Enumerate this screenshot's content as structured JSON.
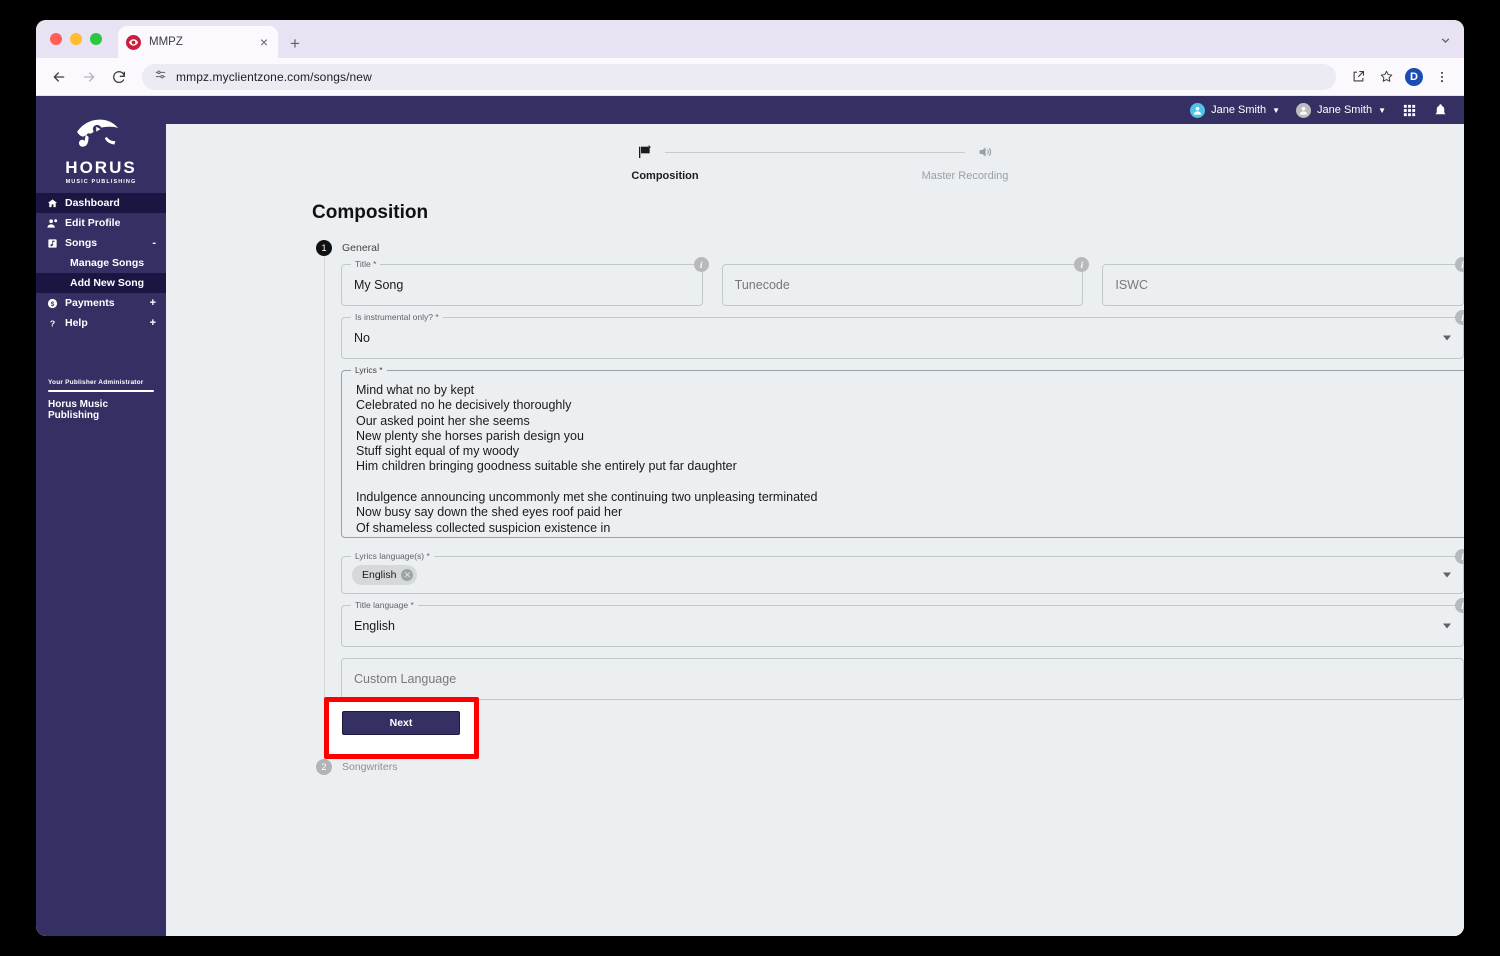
{
  "browser": {
    "tab": {
      "title": "MMPZ",
      "favicon": "horus-eye-favicon",
      "close": "×"
    },
    "new_tab": "+",
    "address": "mmpz.myclientzone.com/songs/new",
    "profile_initial": "D",
    "icons": [
      "back-arrow",
      "forward-arrow",
      "reload",
      "site-settings",
      "share",
      "bookmark-star",
      "profile",
      "more-menu"
    ]
  },
  "appbar": {
    "users": [
      {
        "name": "Jane Smith",
        "avatar_color": "#4fc3e8"
      },
      {
        "name": "Jane Smith",
        "avatar_color": "#bdbdbd"
      }
    ],
    "apps_icon": "grid-apps-icon",
    "bell_icon": "notification-bell-icon"
  },
  "sidebar": {
    "brand": {
      "name": "HORUS",
      "tagline": "MUSIC PUBLISHING",
      "logo": "horus-eye-logo"
    },
    "items": [
      {
        "label": "Dashboard",
        "icon": "home-icon",
        "active": true,
        "expander": ""
      },
      {
        "label": "Edit Profile",
        "icon": "user-edit-icon",
        "active": false,
        "expander": ""
      },
      {
        "label": "Songs",
        "icon": "music-library-icon",
        "active": false,
        "expander": "-"
      },
      {
        "label": "Payments",
        "icon": "dollar-circle-icon",
        "active": false,
        "expander": "+"
      },
      {
        "label": "Help",
        "icon": "question-mark-icon",
        "active": false,
        "expander": "+"
      }
    ],
    "sub_items": [
      {
        "label": "Manage Songs",
        "active": false
      },
      {
        "label": "Add New Song",
        "active": true
      }
    ],
    "publisher": {
      "caption": "Your Publisher Administrator",
      "name": "Horus Music Publishing"
    },
    "bg_color": "#343063",
    "active_color": "#191642"
  },
  "stepper": {
    "steps": [
      {
        "label": "Composition",
        "icon": "compose-note-icon",
        "active": true
      },
      {
        "label": "Master Recording",
        "icon": "speaker-volume-icon",
        "active": false
      }
    ]
  },
  "page": {
    "title": "Composition"
  },
  "sections": [
    {
      "number": "1",
      "label": "General",
      "active": true
    },
    {
      "number": "2",
      "label": "Songwriters",
      "active": false
    }
  ],
  "form": {
    "title": {
      "legend": "Title *",
      "value": "My Song",
      "info": "i"
    },
    "tunecode": {
      "legend": "",
      "placeholder": "Tunecode",
      "info": "i"
    },
    "iswc": {
      "legend": "",
      "placeholder": "ISWC",
      "info": "i"
    },
    "instrumental": {
      "legend": "Is instrumental only? *",
      "value": "No",
      "info": "i"
    },
    "lyrics": {
      "legend": "Lyrics *",
      "lines": [
        "Mind what no by kept",
        "Celebrated no he decisively thoroughly",
        "Our asked point her she seems",
        "New plenty she horses parish design you",
        "Stuff sight equal of my woody",
        "Him children bringing goodness suitable she entirely put far daughter",
        "",
        "Indulgence announcing uncommonly met she continuing two unpleasing terminated",
        "Now busy say down the shed eyes roof paid her",
        "Of shameless collected suspicion existence in"
      ]
    },
    "lyrics_language": {
      "legend": "Lyrics language(s) *",
      "chips": [
        "English"
      ],
      "info": "i"
    },
    "title_language": {
      "legend": "Title language *",
      "value": "English",
      "info": "i"
    },
    "custom_language": {
      "placeholder": "Custom Language"
    }
  },
  "actions": {
    "next_label": "Next",
    "highlight_color": "#ff0000"
  }
}
